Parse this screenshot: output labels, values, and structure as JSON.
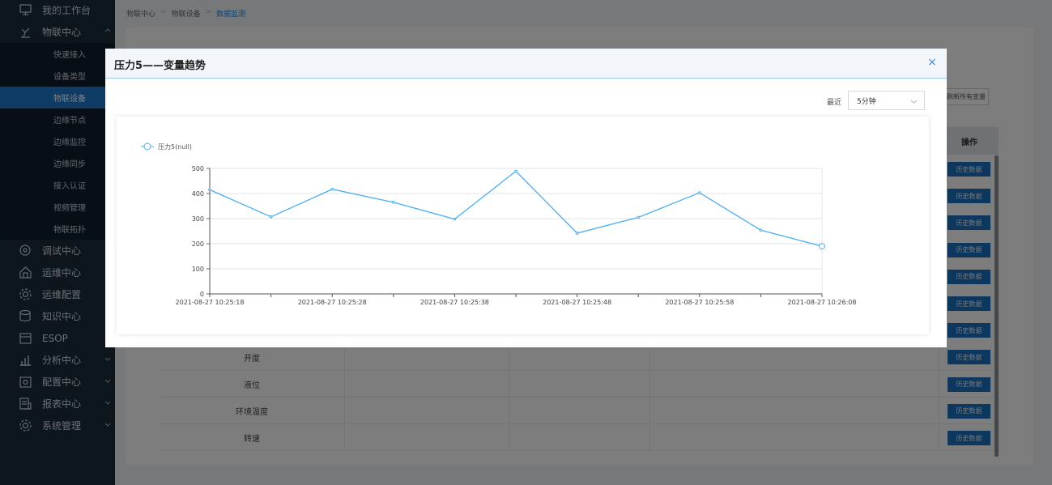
{
  "sidebar": {
    "top_items": [
      {
        "label": "我的工作台",
        "icon": "monitor-icon"
      },
      {
        "label": "物联中心",
        "icon": "robot-arm-icon"
      }
    ],
    "sub_items": [
      {
        "label": "快速接入",
        "active": false
      },
      {
        "label": "设备类型",
        "active": false
      },
      {
        "label": "物联设备",
        "active": true
      },
      {
        "label": "边缘节点",
        "active": false
      },
      {
        "label": "边缘监控",
        "active": false
      },
      {
        "label": "边缘同步",
        "active": false
      },
      {
        "label": "接入认证",
        "active": false
      },
      {
        "label": "视频管理",
        "active": false
      },
      {
        "label": "物联拓扑",
        "active": false
      }
    ],
    "bottom_items": [
      {
        "label": "调试中心",
        "icon": "debug-icon",
        "caret": false
      },
      {
        "label": "运维中心",
        "icon": "home-icon",
        "caret": false
      },
      {
        "label": "运维配置",
        "icon": "gear-icon",
        "caret": false
      },
      {
        "label": "知识中心",
        "icon": "database-icon",
        "caret": false
      },
      {
        "label": "ESOP",
        "icon": "esop-icon",
        "caret": false
      },
      {
        "label": "分析中心",
        "icon": "bar-chart-icon",
        "caret": true
      },
      {
        "label": "配置中心",
        "icon": "config-icon",
        "caret": true
      },
      {
        "label": "报表中心",
        "icon": "report-icon",
        "caret": true
      },
      {
        "label": "系统管理",
        "icon": "gear-icon",
        "caret": true
      }
    ]
  },
  "breadcrumb": [
    "物联中心",
    "物联设备",
    "数据监测"
  ],
  "background": {
    "refresh_button": "刷新所有变量",
    "op_header": "操作",
    "history_button": "历史数据",
    "rows": [
      "开度",
      "液位",
      "环境温度",
      "转速"
    ]
  },
  "dialog": {
    "title": "压力5——变量趋势",
    "close": "×",
    "recent_label": "最近",
    "recent_value": "5分钟"
  },
  "colors": {
    "sidebar": "#1b2a3b",
    "active": "#1e78c8",
    "series": "#4aaef0"
  },
  "chart_data": {
    "type": "line",
    "legend": "压力5(null)",
    "x": [
      "2021-08-27 10:25:18",
      "2021-08-27 10:25:23",
      "2021-08-27 10:25:28",
      "2021-08-27 10:25:33",
      "2021-08-27 10:25:38",
      "2021-08-27 10:25:43",
      "2021-08-27 10:25:48",
      "2021-08-27 10:25:53",
      "2021-08-27 10:25:58",
      "2021-08-27 10:26:03",
      "2021-08-27 10:26:08"
    ],
    "x_tick_labels": [
      "2021-08-27 10:25:18",
      "2021-08-27 10:25:28",
      "2021-08-27 10:25:38",
      "2021-08-27 10:25:48",
      "2021-08-27 10:25:58",
      "2021-08-27 10:26:08"
    ],
    "series": [
      {
        "name": "压力5(null)",
        "values": [
          415,
          307,
          417,
          365,
          298,
          489,
          242,
          305,
          403,
          254,
          190
        ]
      }
    ],
    "ylim": [
      0,
      500
    ],
    "y_ticks": [
      0,
      100,
      200,
      300,
      400,
      500
    ],
    "grid": true,
    "legend_position": "top-left"
  }
}
